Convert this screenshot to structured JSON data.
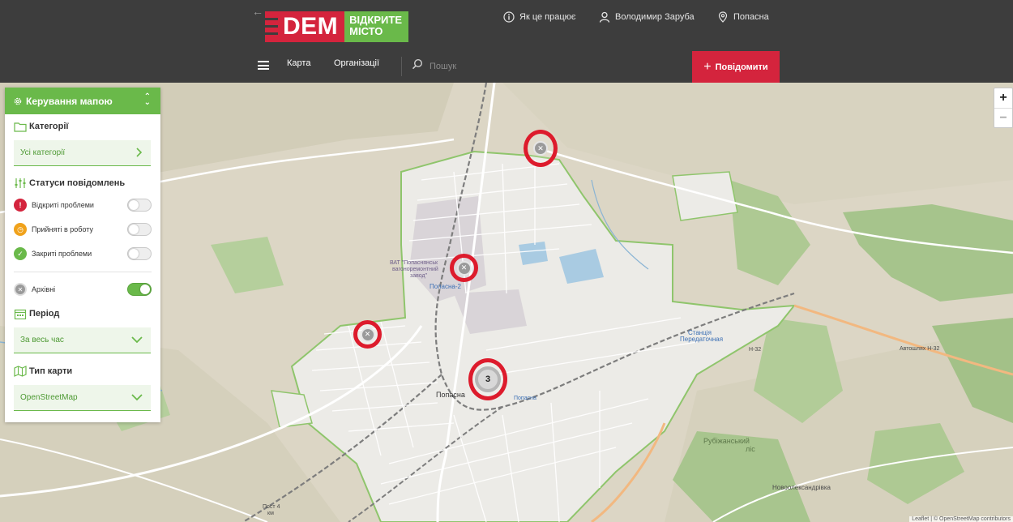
{
  "header": {
    "back_arrow": "←",
    "logo_dem": "DEM",
    "logo_line1": "ВІДКРИТЕ",
    "logo_line2": "МІСТО",
    "how_it_works": "Як це працює",
    "user_name": "Володимир Заруба",
    "city": "Попасна",
    "nav_map": "Карта",
    "nav_orgs": "Організації",
    "search_placeholder": "Пошук",
    "report_label": "Повідомити"
  },
  "panel": {
    "title": "Керування мапою",
    "categories_title": "Категорії",
    "categories_value": "Усі категорії",
    "statuses_title": "Статуси повідомлень",
    "statuses": [
      {
        "label": "Відкриті проблеми",
        "on": false,
        "color": "#d4243d"
      },
      {
        "label": "Прийняті в роботу",
        "on": false,
        "color": "#f0a21b"
      },
      {
        "label": "Закриті проблеми",
        "on": false,
        "color": "#6ab94a"
      }
    ],
    "archived_label": "Архівні",
    "archived_on": true,
    "period_title": "Період",
    "period_value": "За весь час",
    "map_type_title": "Тип карти",
    "map_type_value": "OpenStreetMap"
  },
  "map": {
    "zoom_in": "+",
    "zoom_out": "−",
    "attribution": "Leaflet | © OpenStreetMap contributors",
    "cluster_count": "3",
    "labels": {
      "town": "Попасна",
      "station_popasna2": "Попасна-2",
      "station_popasna": "Попасна",
      "station_peredat_1": "Станція",
      "station_peredat_2": "Передаточная",
      "plant_1": "ВАТ \"Попаснянськ",
      "plant_2": "вагоноремонтний",
      "plant_3": "завод\"",
      "forest_1": "Рубіжанський",
      "forest_2": "ліс",
      "village": "Новоолександрівка",
      "post_1": "Пост 4",
      "post_2": "км",
      "road_n32": "Н-32",
      "road_n32_b": "Автошлях Н-32"
    }
  },
  "colors": {
    "brand_red": "#d4243d",
    "brand_green": "#6ab94a",
    "header_bg": "#3d3d3d"
  }
}
